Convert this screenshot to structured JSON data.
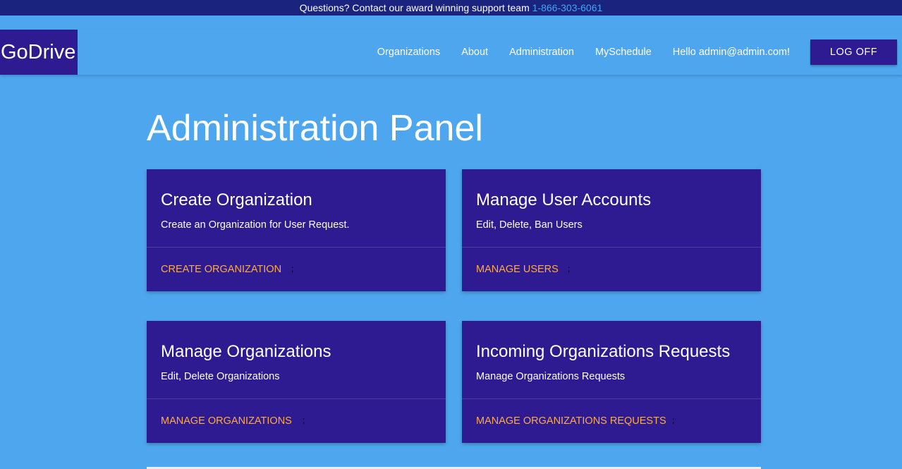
{
  "topbar": {
    "text": "Questions? Contact our award winning support team",
    "phone": "1-866-303-6061"
  },
  "brand": "GoDrive",
  "nav": {
    "links": [
      "Organizations",
      "About",
      "Administration",
      "MySchedule"
    ],
    "greeting": "Hello admin@admin.com!",
    "logoff_label": "LOG OFF"
  },
  "page_title": "Administration Panel",
  "cards": [
    {
      "title": "Create Organization",
      "description": "Create an Organization for User Request.",
      "action": "CREATE ORGANIZATION",
      "sep": ";"
    },
    {
      "title": "Manage User Accounts",
      "description": "Edit, Delete, Ban Users",
      "action": "MANAGE USERS",
      "sep": ";"
    },
    {
      "title": "Manage Organizations",
      "description": "Edit, Delete Organizations",
      "action": "MANAGE ORGANIZATIONS",
      "sep": ";"
    },
    {
      "title": "Incoming Organizations Requests",
      "description": "Manage Organizations Requests",
      "action": "MANAGE ORGANIZATIONS REQUESTS",
      "sep": ";"
    }
  ],
  "colors": {
    "background": "#4ea7ee",
    "topbar": "#1a237e",
    "card": "#2e1a91",
    "action": "#ffab40",
    "phone": "#42a5f5"
  }
}
